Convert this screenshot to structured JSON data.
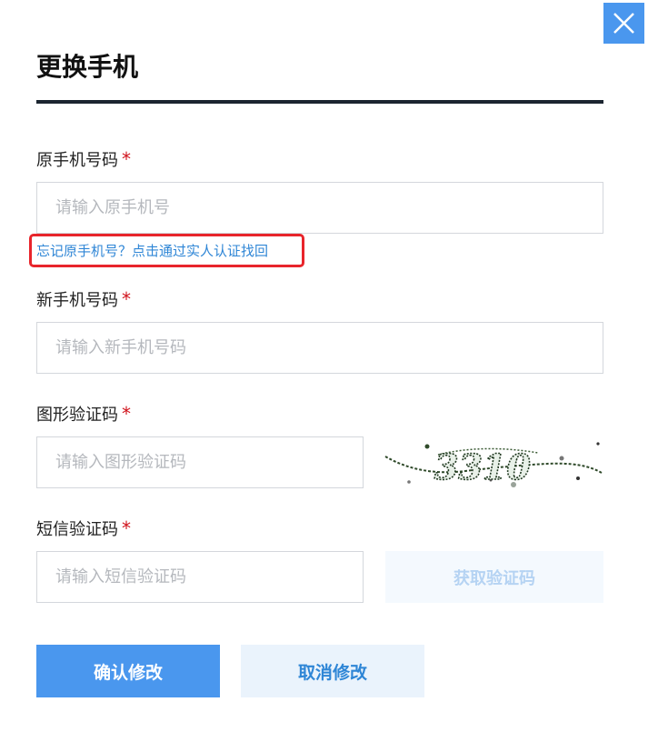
{
  "dialog": {
    "title": "更换手机",
    "close_icon": "close-icon",
    "accent_color": "#4a97ee"
  },
  "form": {
    "old_phone": {
      "label": "原手机号码",
      "required_mark": "*",
      "placeholder": "请输入原手机号",
      "value": ""
    },
    "forgot_link": "忘记原手机号？点击通过实人认证找回",
    "new_phone": {
      "label": "新手机号码",
      "required_mark": "*",
      "placeholder": "请输入新手机号码",
      "value": ""
    },
    "image_code": {
      "label": "图形验证码",
      "required_mark": "*",
      "placeholder": "请输入图形验证码",
      "value": "",
      "captcha_text": "3310"
    },
    "sms_code": {
      "label": "短信验证码",
      "required_mark": "*",
      "placeholder": "请输入短信验证码",
      "value": "",
      "send_button": "获取验证码"
    }
  },
  "actions": {
    "confirm": "确认修改",
    "cancel": "取消修改"
  }
}
